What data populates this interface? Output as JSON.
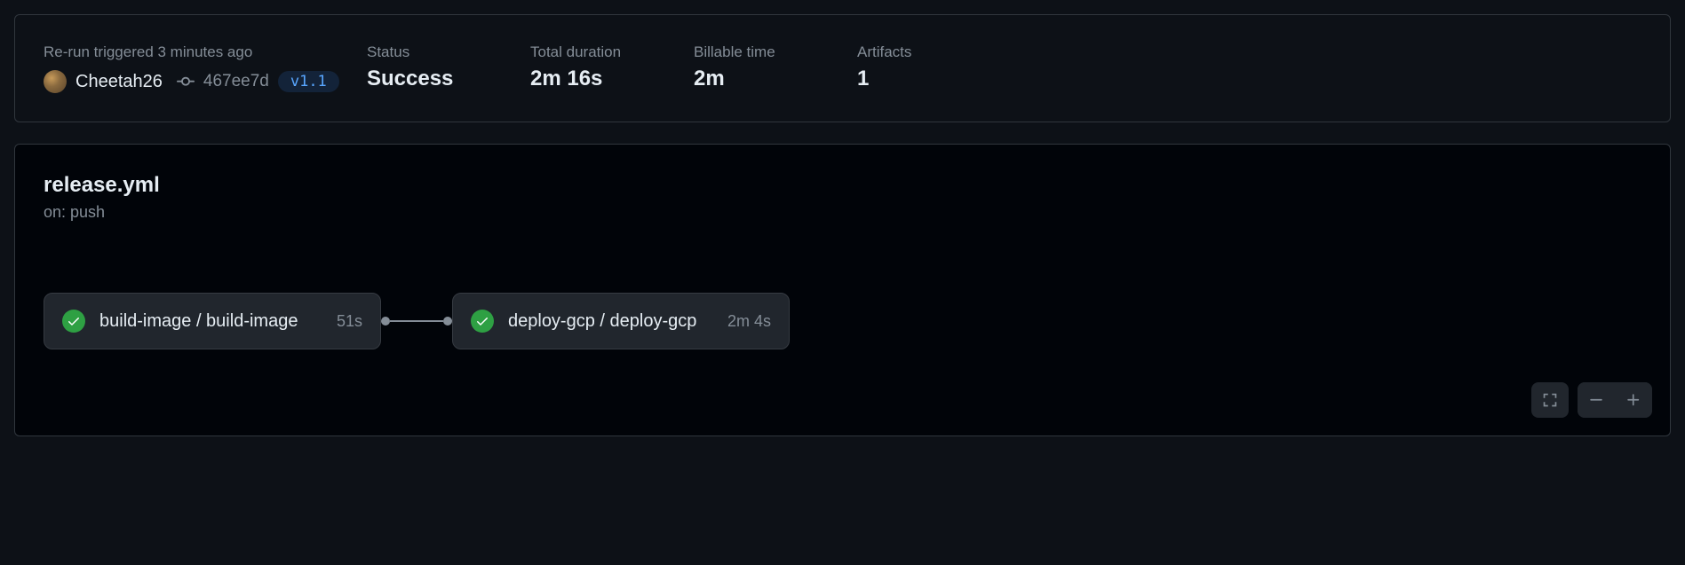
{
  "summary": {
    "trigger_label": "Re-run triggered 3 minutes ago",
    "actor": "Cheetah26",
    "commit_sha": "467ee7d",
    "tag": "v1.1",
    "status_label": "Status",
    "status_value": "Success",
    "duration_label": "Total duration",
    "duration_value": "2m 16s",
    "billable_label": "Billable time",
    "billable_value": "2m",
    "artifacts_label": "Artifacts",
    "artifacts_value": "1"
  },
  "workflow": {
    "file": "release.yml",
    "trigger": "on: push",
    "jobs": [
      {
        "name": "build-image / build-image",
        "duration": "51s"
      },
      {
        "name": "deploy-gcp / deploy-gcp",
        "duration": "2m 4s"
      }
    ]
  }
}
